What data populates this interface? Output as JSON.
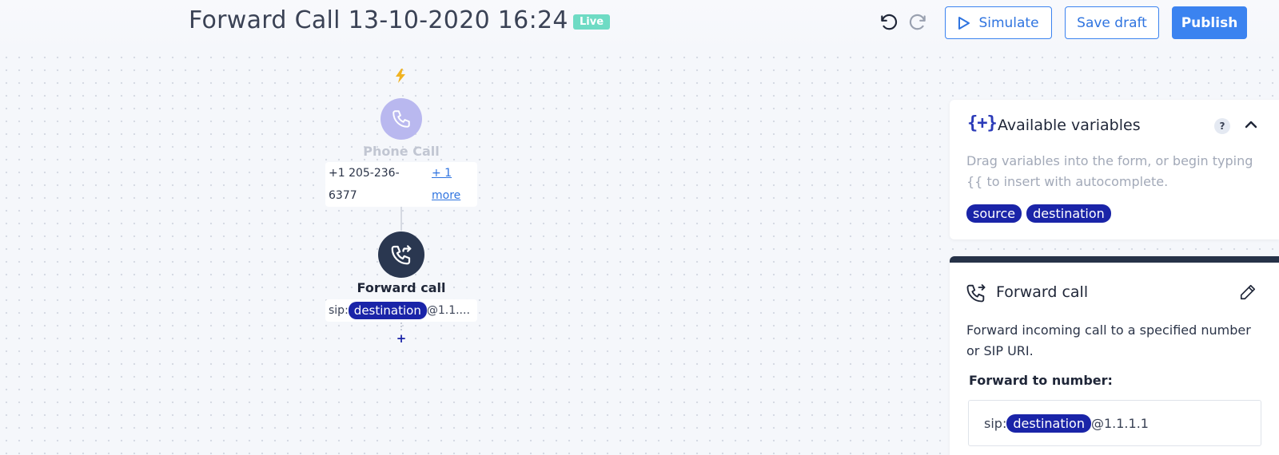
{
  "header": {
    "title": "Forward Call 13-10-2020 16:24",
    "status_badge": "Live",
    "simulate_label": "Simulate",
    "save_draft_label": "Save draft",
    "publish_label": "Publish",
    "undo_icon": "undo-icon",
    "redo_icon": "redo-icon"
  },
  "flow": {
    "trigger": {
      "icon": "lightning-icon",
      "node_icon": "phone-icon",
      "label": "Phone Call",
      "number_line1": "+1 205-236-",
      "number_line2": "6377",
      "more_line1": "+ 1",
      "more_line2": "more"
    },
    "action": {
      "node_icon": "phone-forward-icon",
      "label": "Forward call",
      "value_prefix": "sip:",
      "value_variable": "destination",
      "value_suffix": "@1.1...."
    },
    "add_step_label": "+"
  },
  "variables_panel": {
    "icon": "curly-braces-plus-icon",
    "title": "Available variables",
    "help_label": "?",
    "description": "Drag variables into the form, or begin typing {{ to insert with autocomplete.",
    "variables": [
      "source",
      "destination"
    ]
  },
  "forward_panel": {
    "title": "Forward call",
    "description": "Forward incoming call to a specified number or SIP URI.",
    "field_label": "Forward to number:",
    "field_value_prefix": "sip:",
    "field_value_variable": "destination",
    "field_value_suffix": "@1.1.1.1"
  },
  "colors": {
    "accent": "#3b83f0",
    "variable_chip": "#1a24a8",
    "live_badge": "#6edbc4",
    "trigger_node": "#b9b8ef",
    "action_node": "#2a3750"
  }
}
